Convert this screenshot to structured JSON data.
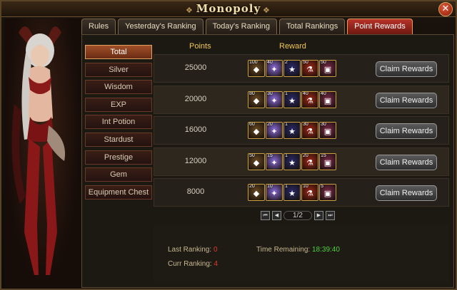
{
  "window": {
    "title": "Monopoly"
  },
  "tabs": [
    {
      "label": "Rules"
    },
    {
      "label": "Yesterday's Ranking"
    },
    {
      "label": "Today's Ranking"
    },
    {
      "label": "Total Rankings"
    },
    {
      "label": "Point Rewards"
    }
  ],
  "sidebar": {
    "items": [
      {
        "label": "Total"
      },
      {
        "label": "Silver"
      },
      {
        "label": "Wisdom"
      },
      {
        "label": "EXP"
      },
      {
        "label": "Int Potion"
      },
      {
        "label": "Stardust"
      },
      {
        "label": "Prestige"
      },
      {
        "label": "Gem"
      },
      {
        "label": "Equipment Chest"
      }
    ]
  },
  "table": {
    "col_points": "Points",
    "col_reward": "Reward",
    "claim_label": "Claim Rewards",
    "rows": [
      {
        "points": "25000",
        "items": [
          {
            "count": "100",
            "icon": "money-bag-icon",
            "color": "#6a4a24",
            "glyph": "◆"
          },
          {
            "count": "40",
            "icon": "feather-scroll-icon",
            "color": "#8a6ad8",
            "glyph": "✦"
          },
          {
            "count": "2",
            "icon": "star-potion-icon",
            "color": "#2a2a6a",
            "glyph": "★"
          },
          {
            "count": "50",
            "icon": "red-potion-icon",
            "color": "#a0281a",
            "glyph": "⚗"
          },
          {
            "count": "50",
            "icon": "treasure-chest-icon",
            "color": "#7a2a4a",
            "glyph": "▣"
          }
        ]
      },
      {
        "points": "20000",
        "items": [
          {
            "count": "80",
            "icon": "money-bag-icon",
            "color": "#6a4a24",
            "glyph": "◆"
          },
          {
            "count": "30",
            "icon": "feather-scroll-icon",
            "color": "#8a6ad8",
            "glyph": "✦"
          },
          {
            "count": "1",
            "icon": "star-potion-icon",
            "color": "#2a2a6a",
            "glyph": "★"
          },
          {
            "count": "40",
            "icon": "red-potion-icon",
            "color": "#a0281a",
            "glyph": "⚗"
          },
          {
            "count": "40",
            "icon": "treasure-chest-icon",
            "color": "#7a2a4a",
            "glyph": "▣"
          }
        ]
      },
      {
        "points": "16000",
        "items": [
          {
            "count": "60",
            "icon": "money-bag-icon",
            "color": "#6a4a24",
            "glyph": "◆"
          },
          {
            "count": "20",
            "icon": "feather-scroll-icon",
            "color": "#8a6ad8",
            "glyph": "✦"
          },
          {
            "count": "1",
            "icon": "star-potion-icon",
            "color": "#2a2a6a",
            "glyph": "★"
          },
          {
            "count": "30",
            "icon": "red-potion-icon",
            "color": "#a0281a",
            "glyph": "⚗"
          },
          {
            "count": "30",
            "icon": "treasure-chest-icon",
            "color": "#7a2a4a",
            "glyph": "▣"
          }
        ]
      },
      {
        "points": "12000",
        "items": [
          {
            "count": "50",
            "icon": "money-bag-icon",
            "color": "#6a4a24",
            "glyph": "◆"
          },
          {
            "count": "15",
            "icon": "feather-scroll-icon",
            "color": "#8a6ad8",
            "glyph": "✦"
          },
          {
            "count": "1",
            "icon": "star-potion-icon",
            "color": "#2a2a6a",
            "glyph": "★"
          },
          {
            "count": "20",
            "icon": "red-potion-icon",
            "color": "#a0281a",
            "glyph": "⚗"
          },
          {
            "count": "15",
            "icon": "treasure-chest-icon",
            "color": "#7a2a4a",
            "glyph": "▣"
          }
        ]
      },
      {
        "points": "8000",
        "items": [
          {
            "count": "20",
            "icon": "money-bag-icon",
            "color": "#6a4a24",
            "glyph": "◆"
          },
          {
            "count": "10",
            "icon": "feather-scroll-icon",
            "color": "#8a6ad8",
            "glyph": "✦"
          },
          {
            "count": "1",
            "icon": "star-potion-icon",
            "color": "#2a2a6a",
            "glyph": "★"
          },
          {
            "count": "10",
            "icon": "red-potion-icon",
            "color": "#a0281a",
            "glyph": "⚗"
          },
          {
            "count": "5",
            "icon": "treasure-chest-icon",
            "color": "#7a2a4a",
            "glyph": "▣"
          }
        ]
      }
    ]
  },
  "pager": {
    "page": "1/2"
  },
  "stats": {
    "last_ranking_label": "Last Ranking:",
    "last_ranking_value": "0",
    "curr_ranking_label": "Curr Ranking:",
    "curr_ranking_value": "4",
    "time_remaining_label": "Time Remaining:",
    "time_remaining_value": "18:39:40"
  }
}
